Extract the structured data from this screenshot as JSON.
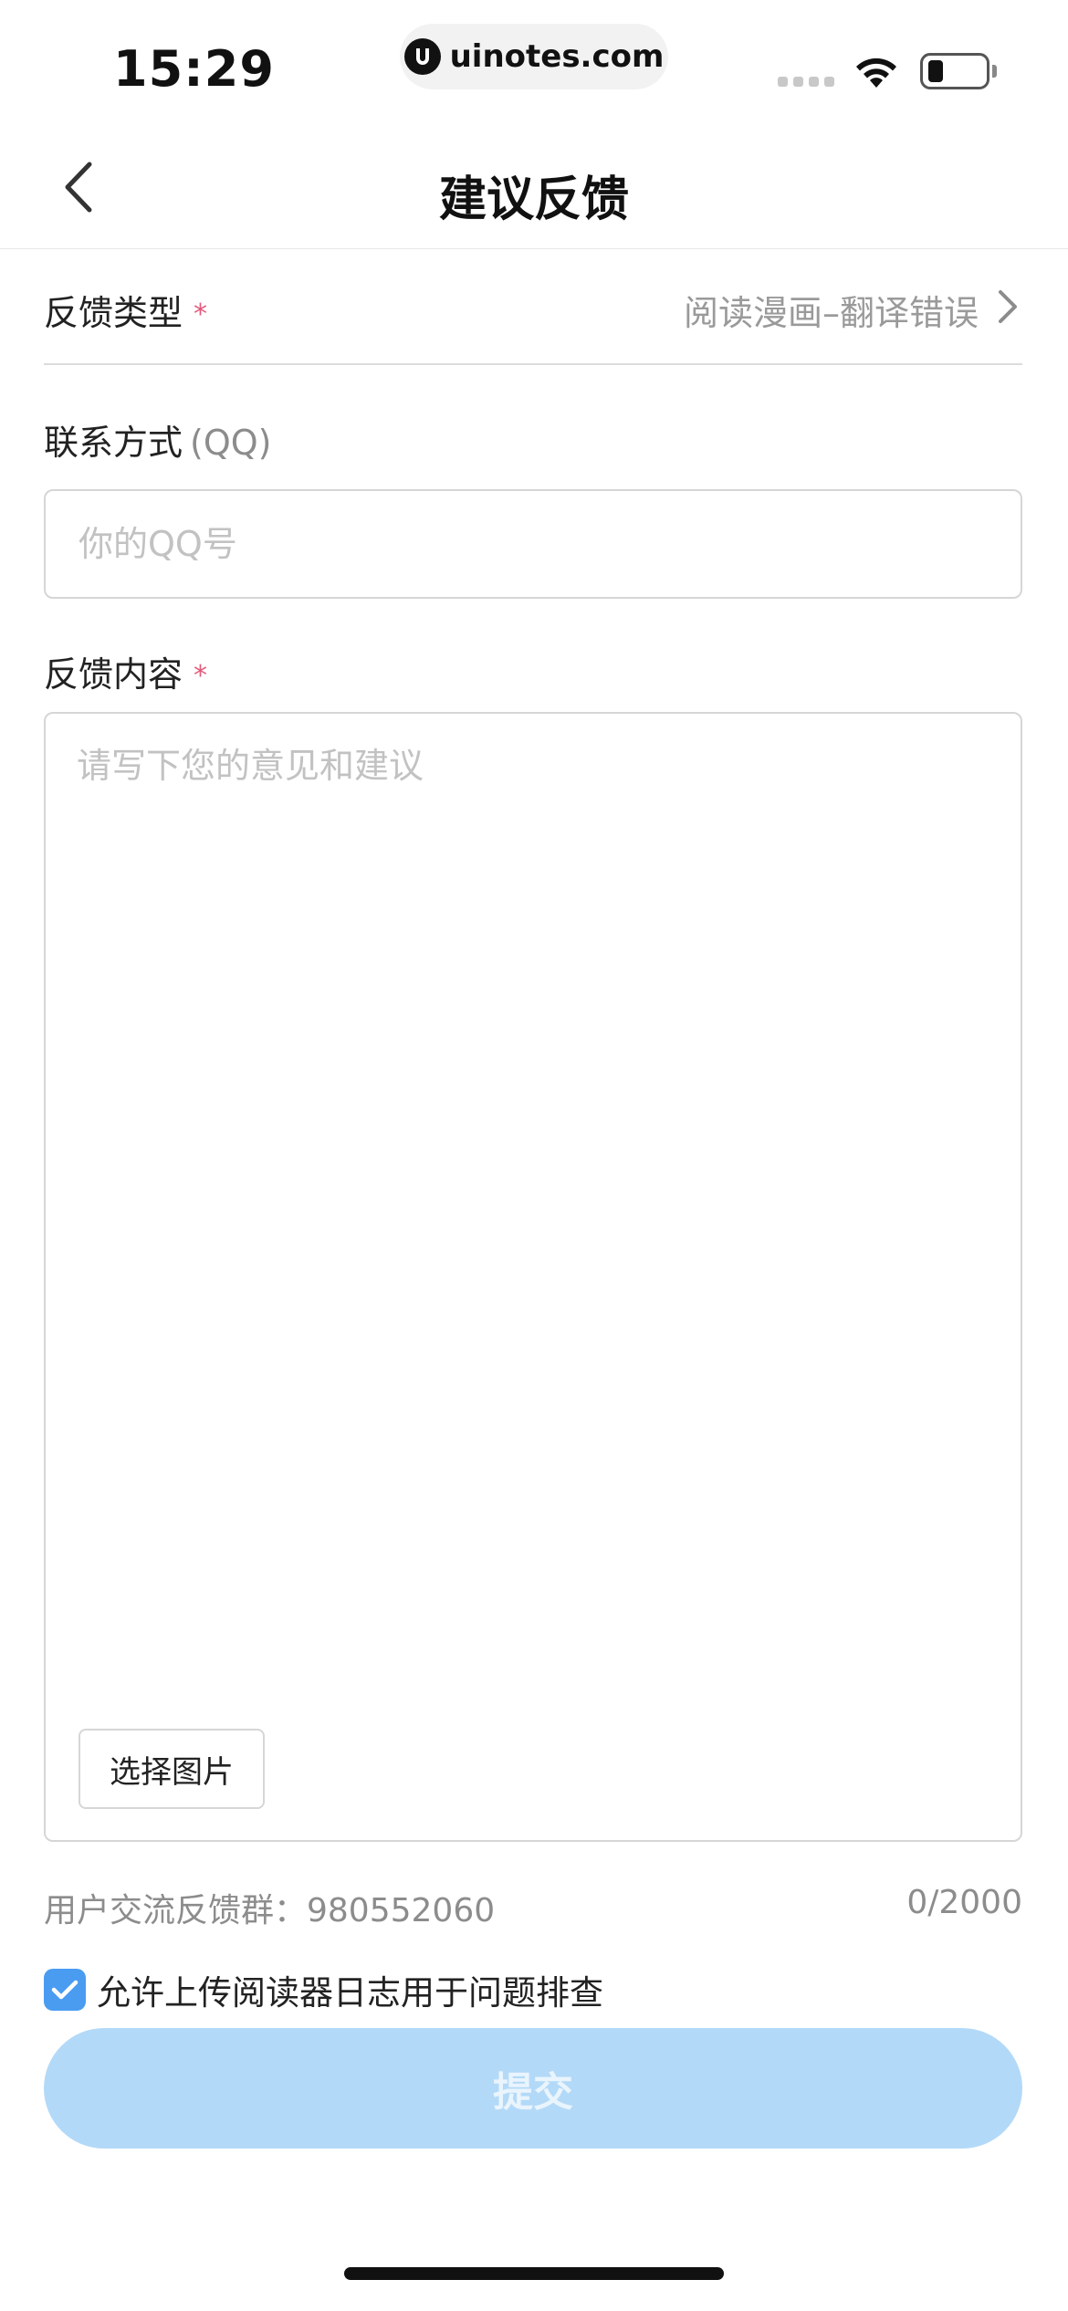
{
  "status_bar": {
    "time": "15:29",
    "url": "uinotes.com",
    "icons": [
      "cellular-signal-icon",
      "wifi-icon",
      "battery-icon"
    ],
    "battery_level": 0.25
  },
  "nav": {
    "title": "建议反馈",
    "back_icon": "chevron-left-icon"
  },
  "form": {
    "type": {
      "label": "反馈类型",
      "required_mark": "*",
      "value": "阅读漫画–翻译错误",
      "chevron_icon": "chevron-right-icon"
    },
    "contact": {
      "label": "联系方式",
      "hint": "(QQ)",
      "value": "",
      "placeholder": "你的QQ号"
    },
    "content": {
      "label": "反馈内容",
      "required_mark": "*",
      "value": "",
      "placeholder": "请写下您的意见和建议",
      "pick_image_label": "选择图片"
    },
    "group_info": "用户交流反馈群：980552060",
    "char_count": "0/2000",
    "upload_log": {
      "checked": true,
      "label": "允许上传阅读器日志用于问题排查"
    },
    "submit_label": "提交"
  },
  "colors": {
    "accent": "#4a9cf1",
    "submit_disabled_bg": "#b3d9f8",
    "required": "#e35a7b",
    "muted_text": "#8c8c8c",
    "placeholder": "#c2c2c2"
  }
}
